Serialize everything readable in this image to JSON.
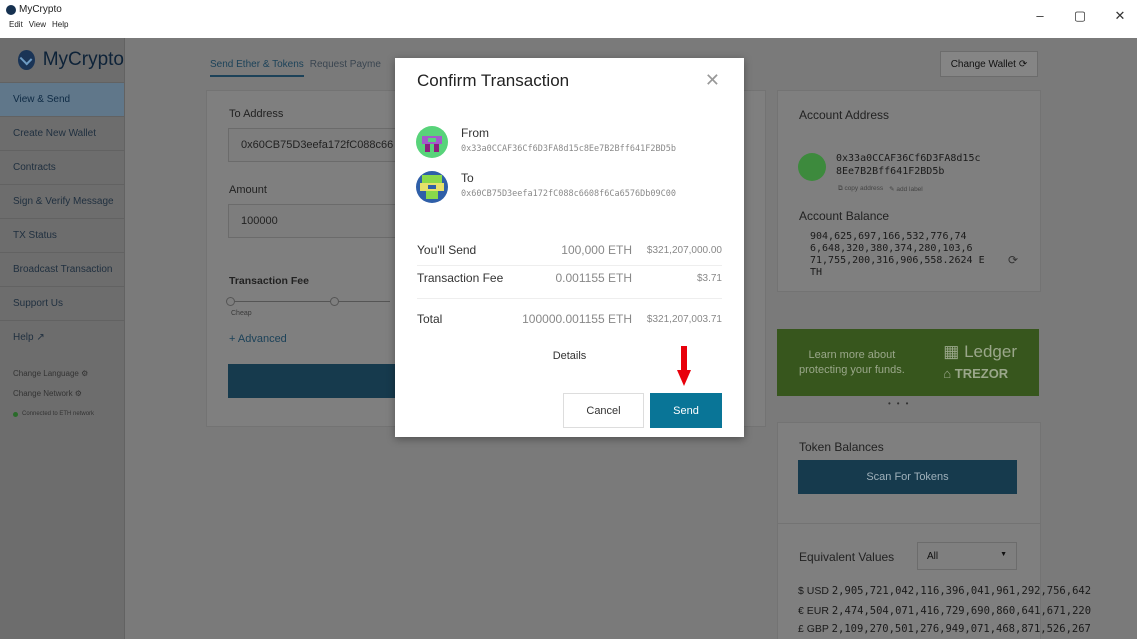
{
  "window": {
    "title": "MyCrypto",
    "menu": [
      "Edit",
      "View",
      "Help"
    ],
    "controls": [
      "–",
      "▢",
      "✕"
    ]
  },
  "sidebar": {
    "logo": "MyCrypto",
    "items": [
      {
        "label": "View & Send"
      },
      {
        "label": "Create New Wallet"
      },
      {
        "label": "Contracts"
      },
      {
        "label": "Sign & Verify Message"
      },
      {
        "label": "TX Status"
      },
      {
        "label": "Broadcast Transaction"
      },
      {
        "label": "Support Us"
      },
      {
        "label": "Help ↗"
      }
    ],
    "change_language": "Change Language ⚙",
    "change_network": "Change Network ⚙",
    "network_status": "Connected to ETH network"
  },
  "main": {
    "tabs": [
      "Send Ether & Tokens",
      "Request Payme"
    ],
    "to_label": "To Address",
    "to_value": "0x60CB75D3eefa172fC088c66",
    "amount_label": "Amount",
    "amount_value": "100000",
    "fee_label": "Transaction Fee",
    "fee_cheap": "Cheap",
    "advanced": "+ Advanced"
  },
  "right": {
    "change_wallet": "Change Wallet",
    "account_address_title": "Account Address",
    "address_line1": "0x33a0CCAF36Cf6D3FA8d15c",
    "address_line2": "8Ee7B2Bff641F2BD5b",
    "copy_address": "⧉ copy address",
    "add_label": "✎ add label",
    "balance_title": "Account Balance",
    "balance_lines": [
      "904,625,697,166,532,776,74",
      "6,648,320,380,374,280,103,6",
      "71,755,200,316,906,558.2624 E",
      "TH"
    ],
    "banner_text1": "Learn more about",
    "banner_text2": "protecting your funds.",
    "banner_brand1": "Ledger",
    "banner_brand2": "TREZOR",
    "token_title": "Token Balances",
    "scan_button": "Scan For Tokens",
    "equiv_title": "Equivalent Values",
    "equiv_select": "All",
    "equiv": [
      {
        "label": "$ USD",
        "value": "2,905,721,042,116,396,041,961,292,756,642"
      },
      {
        "label": "€ EUR",
        "value": "2,474,504,071,416,729,690,860,641,671,220"
      },
      {
        "label": "£ GBP",
        "value": "2,109,270,501,276,949,071,468,871,526,267"
      }
    ]
  },
  "modal": {
    "title": "Confirm Transaction",
    "close": "✕",
    "from_label": "From",
    "from_address": "0x33a0CCAF36Cf6D3FA8d15c8Ee7B2Bff641F2BD5b",
    "to_label": "To",
    "to_address": "0x60CB75D3eefa172fC088c6608f6Ca6576Db09C00",
    "send_label": "You'll Send",
    "send_eth": "100,000 ETH",
    "send_usd": "$321,207,000.00",
    "fee_label": "Transaction Fee",
    "fee_eth": "0.001155 ETH",
    "fee_usd": "$3.71",
    "total_label": "Total",
    "total_eth": "100000.001155 ETH",
    "total_usd": "$321,207,003.71",
    "details": "Details",
    "cancel": "Cancel",
    "send": "Send"
  },
  "colors": {
    "accent": "#097597",
    "overlay": "#7a7a7a",
    "arrow": "#e8000b"
  }
}
